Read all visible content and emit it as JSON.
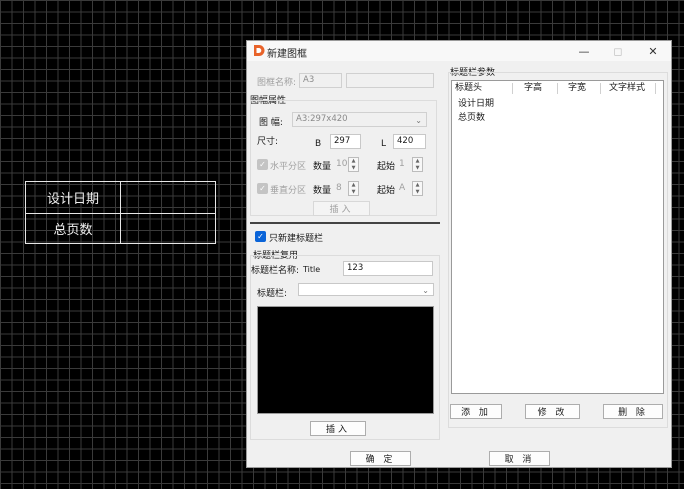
{
  "canvas": {
    "table": [
      "设计日期",
      "总页数"
    ]
  },
  "dialog": {
    "title": "新建图框",
    "frame_name_label": "图框名称:",
    "frame_name_value": "A3",
    "sheet_props_group": "图幅属性",
    "sheet_size_label": "图  幅:",
    "sheet_size_value": "A3:297x420",
    "dimension_label": "尺寸:",
    "b_label": "B",
    "b_value": "297",
    "l_label": "L",
    "l_value": "420",
    "h_partition_label": "水平分区",
    "v_partition_label": "垂直分区",
    "count_label": "数量",
    "h_count": "10",
    "v_count": "8",
    "start_label": "起始",
    "h_start": "1",
    "v_start": "A",
    "insert_label": "插入",
    "only_titlebar_label": "只新建标题栏",
    "only_titlebar_checked": true,
    "reuse_group": "标题栏复用",
    "titlebar_name_label": "标题栏名称:",
    "titlebar_name_hint": "Title",
    "titlebar_name_value": "123",
    "titlebar_label": "标题栏:",
    "titlebar_select_value": "",
    "preview_insert_label": "插入",
    "params_group": "标题栏参数",
    "params_columns": [
      "标题头",
      "字高",
      "字宽",
      "文字样式"
    ],
    "params_rows": [
      "设计日期",
      "总页数"
    ],
    "add_label": "添 加",
    "edit_label": "修 改",
    "delete_label": "删 除",
    "ok_label": "确 定",
    "cancel_label": "取 消"
  },
  "colors": {
    "accent": "#0a64d8",
    "logo": "#e8632a",
    "canvas_bg": "#000000",
    "grid": "#3a3a3a"
  }
}
